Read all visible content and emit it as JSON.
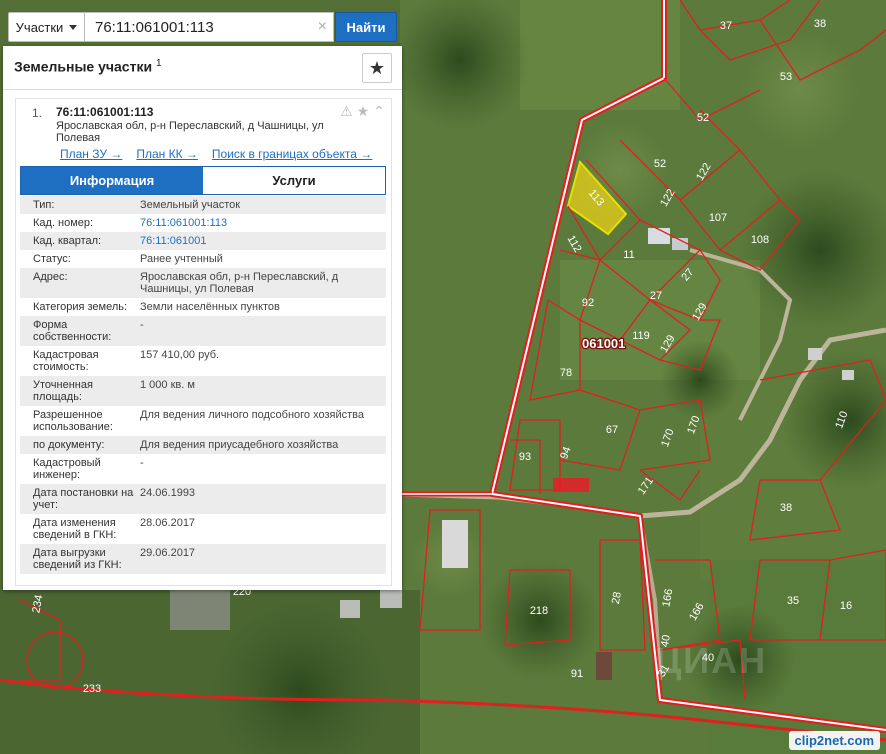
{
  "search": {
    "type_label": "Участки",
    "value": "76:11:061001:113",
    "find_label": "Найти"
  },
  "panel": {
    "title": "Земельные участки",
    "title_count": "1"
  },
  "result": {
    "index": "1.",
    "cadastral_id": "76:11:061001:113",
    "address": "Ярославская обл, р-н Переславский, д Чашницы, ул Полевая",
    "links": [
      "План ЗУ →",
      "План КК →",
      "Поиск в границах объекта →"
    ],
    "tabs": [
      "Информация",
      "Услуги"
    ],
    "properties": [
      {
        "key": "Тип:",
        "value": "Земельный участок"
      },
      {
        "key": "Кад. номер:",
        "value": "76:11:061001:113"
      },
      {
        "key": "Кад. квартал:",
        "value": "76:11:061001"
      },
      {
        "key": "Статус:",
        "value": "Ранее учтенный"
      },
      {
        "key": "Адрес:",
        "value": "Ярославская обл, р-н Переславский, д Чашницы, ул Полевая"
      },
      {
        "key": "Категория земель:",
        "value": "Земли населённых пунктов"
      },
      {
        "key": "Форма собственности:",
        "value": "-"
      },
      {
        "key": "Кадастровая стоимость:",
        "value": "157 410,00 руб."
      },
      {
        "key": "Уточненная площадь:",
        "value": "1 000 кв. м"
      },
      {
        "key": "Разрешенное использование:",
        "value": "Для ведения личного подсобного хозяйства"
      },
      {
        "key": "по документу:",
        "value": "Для ведения приусадебного хозяйства"
      },
      {
        "key": "Кадастровый инженер:",
        "value": "-"
      },
      {
        "key": "Дата постановки на учет:",
        "value": "24.06.1993"
      },
      {
        "key": "Дата изменения сведений в ГКН:",
        "value": "28.06.2017"
      },
      {
        "key": "Дата выгрузки сведений из ГКН:",
        "value": "29.06.2017"
      }
    ]
  },
  "map": {
    "quarter_label": "061001",
    "selected_plot": "113",
    "plot_labels": [
      "37",
      "38",
      "53",
      "52",
      "52",
      "122",
      "122",
      "113",
      "107",
      "112",
      "11",
      "108",
      "27",
      "27",
      "92",
      "129",
      "129",
      "119",
      "78",
      "67",
      "170",
      "170",
      "94",
      "93",
      "171",
      "110",
      "38",
      "218",
      "28",
      "166",
      "166",
      "40",
      "40",
      "31",
      "91",
      "35",
      "16",
      "234",
      "233",
      "220"
    ],
    "watermark": "clip2net.com",
    "faint_watermark": "ЦИАН"
  },
  "colors": {
    "accent": "#1e6fc2",
    "boundary": "#e02020",
    "selected_fill": "#e8d21a"
  }
}
